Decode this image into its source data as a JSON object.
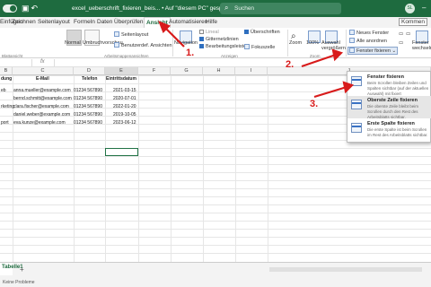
{
  "titlebar": {
    "file_name": "excel_ueberschrift_fixieren_beis... • Auf \"diesem PC\" gespeichert",
    "file_chevron": "⌄",
    "search_placeholder": "Suchen",
    "search_icon": "search-icon",
    "user_initials": "SL",
    "minimize": "–"
  },
  "tabs": [
    "Einfügen",
    "Zeichnen",
    "Seitenlayout",
    "Formeln",
    "Daten",
    "Überprüfen",
    "Ansicht",
    "Automatisieren",
    "Hilfe"
  ],
  "active_tab": "Ansicht",
  "ribbon": {
    "zoom_label": "Zoom",
    "zoom_pct": "100%",
    "selection_zoom": "Auswahl vergrößern",
    "normal": "Normal",
    "page_break": "Umbruchvorschau",
    "page_layout": "Seitenlayout",
    "custom_views": "Benutzerdef. Ansichten",
    "navigation": "Navigation",
    "ruler": "Lineal",
    "gridlines": "Gitternetzlinien",
    "formula_bar": "Bearbeitungsleiste",
    "headings": "Überschriften",
    "focus_cell": "Fokuszelle",
    "new_window": "Neues Fenster",
    "arrange_all": "Alle anordnen",
    "freeze_panes": "Fenster fixieren",
    "freeze_chevron": "⌄",
    "group_views": "Arbeitsmappenansichten",
    "group_show": "Anzeigen",
    "group_zoom": "Zoom",
    "group_sheet_view": "Blattansicht",
    "switch_window": "Fenster wechseln",
    "comments": "Kommen"
  },
  "columns": [
    {
      "label": "B",
      "selected": false
    },
    {
      "label": "C",
      "selected": false
    },
    {
      "label": "D",
      "selected": false
    },
    {
      "label": "E",
      "selected": true
    },
    {
      "label": "F",
      "selected": false
    },
    {
      "label": "G",
      "selected": false
    },
    {
      "label": "H",
      "selected": false
    },
    {
      "label": "I",
      "selected": false
    },
    {
      "label": "J",
      "selected": false
    }
  ],
  "table": {
    "headers": [
      "dung",
      "E-Mail",
      "Telefon",
      "Eintrittsdatum"
    ],
    "rows": [
      [
        "eb",
        "anna.mueller@example.com",
        "01234 567890",
        "2021-03-15"
      ],
      [
        "",
        "bernd.schmitt@example.com",
        "01234 567890",
        "2020-07-01"
      ],
      [
        "rketing",
        "clara.fischer@example.com",
        "01234 567890",
        "2022-01-20"
      ],
      [
        "",
        "daniel.weber@example.com",
        "01234 567890",
        "2019-10-05"
      ],
      [
        "port",
        "eva.kunze@example.com",
        "01234 567890",
        "2023-06-12"
      ]
    ]
  },
  "freeze_menu": [
    {
      "title": "Fenster fixieren",
      "desc": "Beim Scrollen bleiben Zeilen und Spalten sichtbar (auf der aktuellen Auswahl) mit fixiert",
      "highlighted": false
    },
    {
      "title": "Oberste Zeile fixieren",
      "desc": "Die oberste Zeile bleibt beim Scrollen durch den Rest des Arbeitsblatts sichtbar.",
      "highlighted": true
    },
    {
      "title": "Erste Spalte fixieren",
      "desc": "Die erste Spalte ist beim Scrollen im Rest des Arbeitsblatts sichtbar.",
      "highlighted": false
    }
  ],
  "annotations": [
    "1.",
    "2.",
    "3."
  ],
  "sheetbar": {
    "sheet_tab": "Tabelle1",
    "add_sheet": "+"
  },
  "statusbar": {
    "text": "Keine Probleme"
  },
  "colors": {
    "title_green": "#1e6b3f",
    "annotation_red": "#d81b1b",
    "selection_green": "#217346"
  }
}
